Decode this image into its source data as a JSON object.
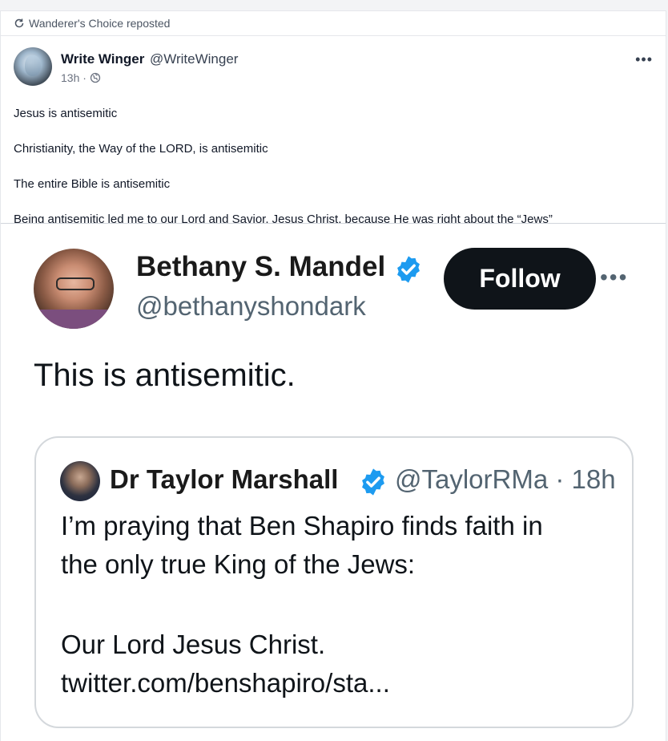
{
  "repost": {
    "text": "Wanderer's Choice reposted",
    "icon": "repost-icon"
  },
  "author": {
    "name": "Write Winger",
    "handle": "@WriteWinger",
    "time": "13h ·",
    "visibility_icon": "globe-icon"
  },
  "post": {
    "lines": [
      "Jesus is antisemitic",
      "Christianity, the Way of the LORD, is antisemitic",
      "The entire Bible is antisemitic",
      "Being antisemitic led me to our Lord and Savior, Jesus Christ, because He was right about the “Jews”"
    ]
  },
  "embedded_tweet": {
    "name": "Bethany S. Mandel",
    "handle": "@bethanyshondark",
    "follow_label": "Follow",
    "text": "This is antisemitic.",
    "quote": {
      "name": "Dr Taylor Marshall",
      "handle_time": "@TaylorRMa · 18h",
      "lines": [
        "I’m praying that Ben Shapiro finds faith in",
        "the only true King of the Jews:",
        "Our Lord Jesus Christ.",
        "twitter.com/benshapiro/sta..."
      ]
    }
  },
  "colors": {
    "verified": "#1d9bf0",
    "follow_bg": "#0f1419",
    "muted": "#536471"
  }
}
